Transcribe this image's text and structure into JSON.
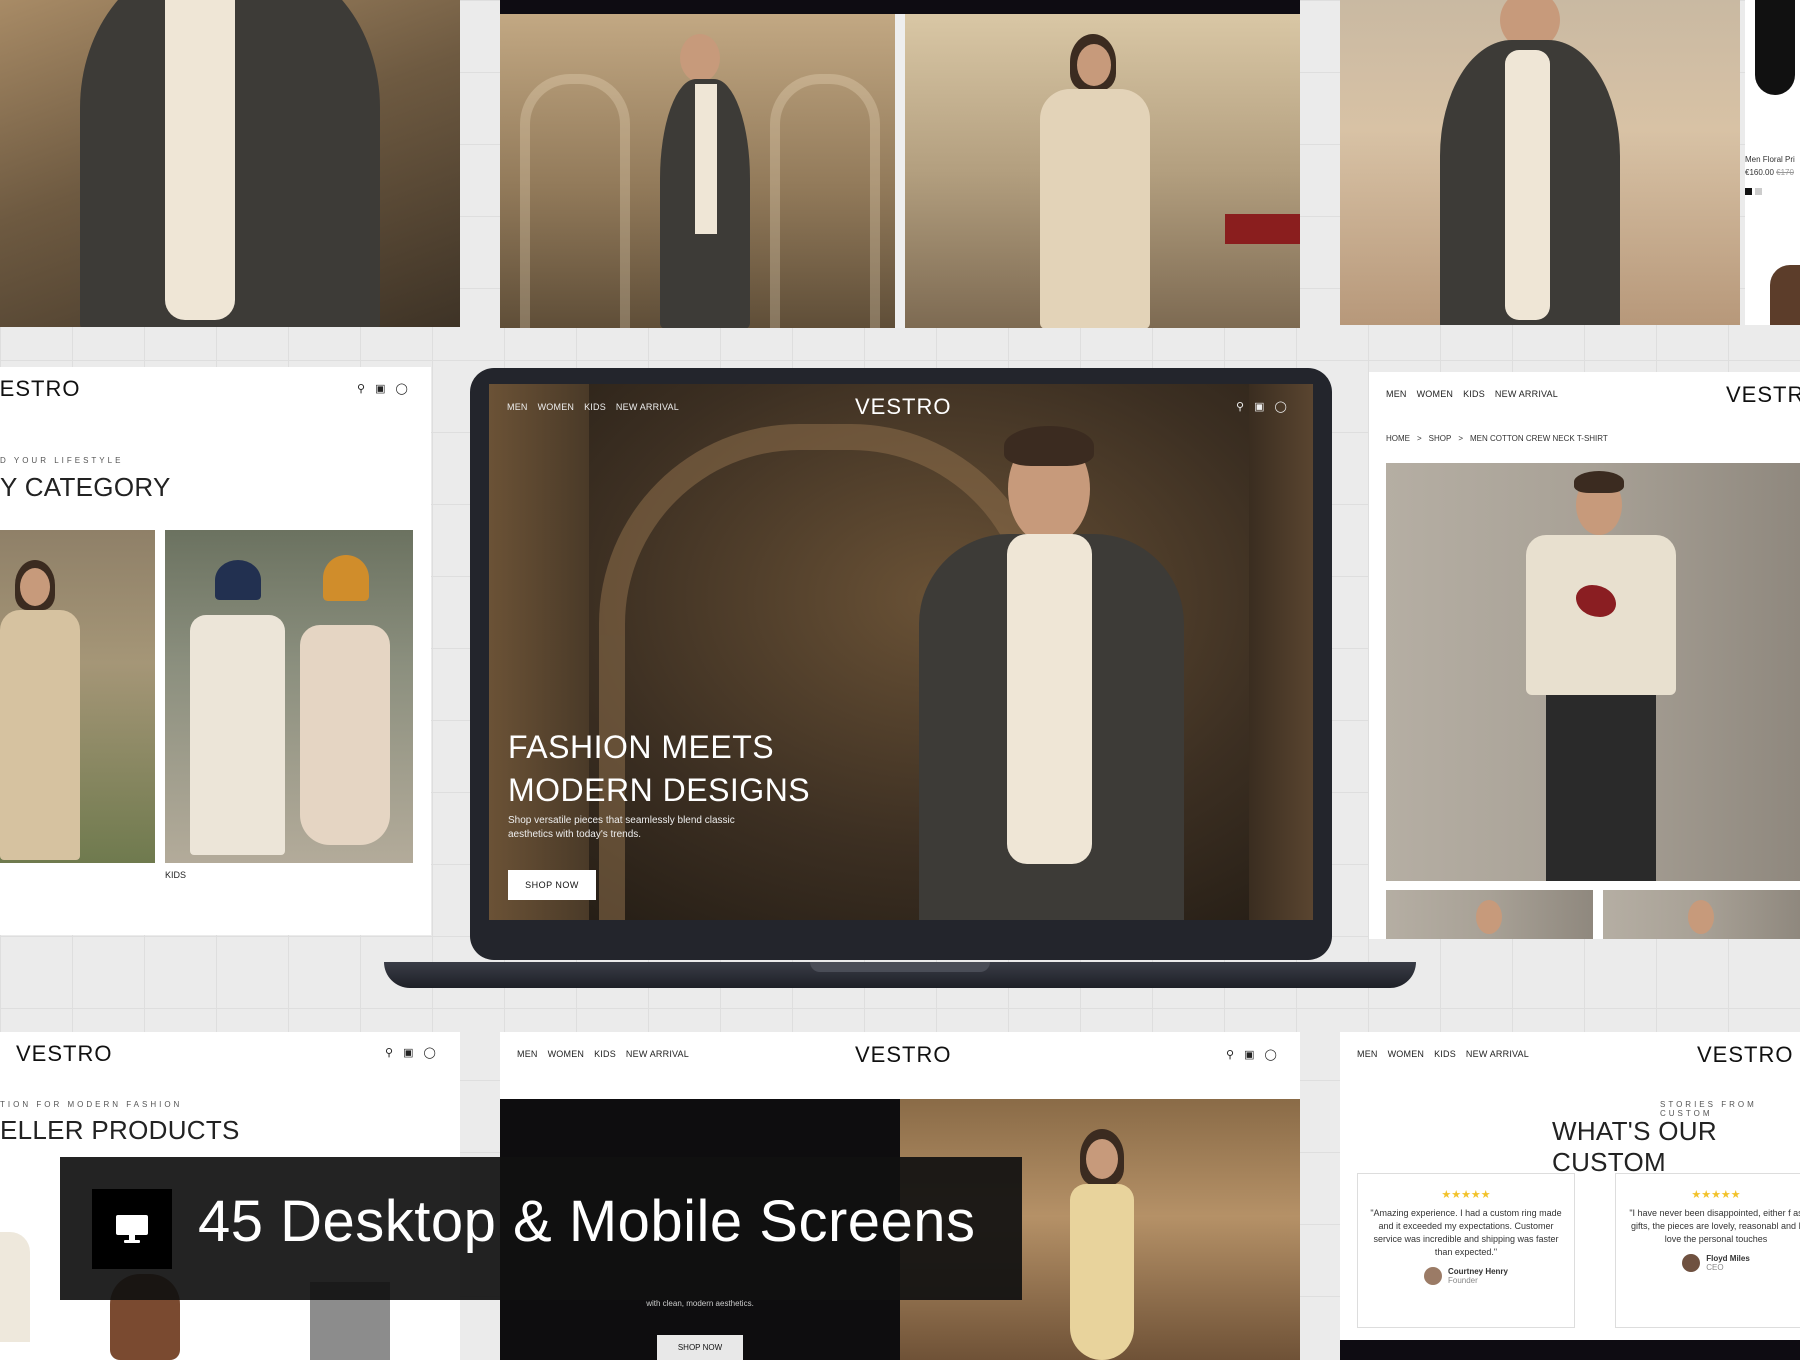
{
  "brand": "VESTRO",
  "nav": [
    "MEN",
    "WOMEN",
    "KIDS",
    "NEW ARRIVAL"
  ],
  "hero": {
    "title_line1": "FASHION MEETS",
    "title_line2": "MODERN DESIGNS",
    "subtitle": "Shop versatile pieces that seamlessly blend classic aesthetics with today's trends.",
    "button": "SHOP NOW"
  },
  "category_card": {
    "kicker": "D YOUR LIFESTYLE",
    "title": "Y CATEGORY",
    "kids_label": "KIDS"
  },
  "product_card": {
    "breadcrumb": [
      "HOME",
      "SHOP",
      "MEN COTTON CREW NECK T-SHIRT"
    ],
    "separator": ">"
  },
  "side_product": {
    "name": "Men Floral Pri",
    "price": "€160.00",
    "old_price": "€170"
  },
  "seller_card": {
    "kicker": "TION FOR MODERN FASHION",
    "title": "ELLER PRODUCTS"
  },
  "dark_card": {
    "text": "with clean, modern aesthetics.",
    "button": "SHOP NOW"
  },
  "reviews_card": {
    "kicker": "STORIES FROM CUSTOM",
    "title": "WHAT'S OUR CUSTOM",
    "reviews": [
      {
        "stars": "★★★★★",
        "text": "\"Amazing experience. I had a custom ring made and it exceeded my expectations. Customer service was incredible and shipping was faster than expected.\"",
        "name": "Courtney Henry",
        "role": "Founder"
      },
      {
        "stars": "★★★★★",
        "text": "\"I have never been disappointed, either f as gifts, the pieces are lovely, reasonabl and I love the personal touches",
        "name": "Floyd Miles",
        "role": "CEO"
      }
    ]
  },
  "banner": {
    "text": "45 Desktop & Mobile Screens",
    "icon": "monitor-icon"
  },
  "icons": [
    "search-icon",
    "bag-icon",
    "user-icon"
  ]
}
